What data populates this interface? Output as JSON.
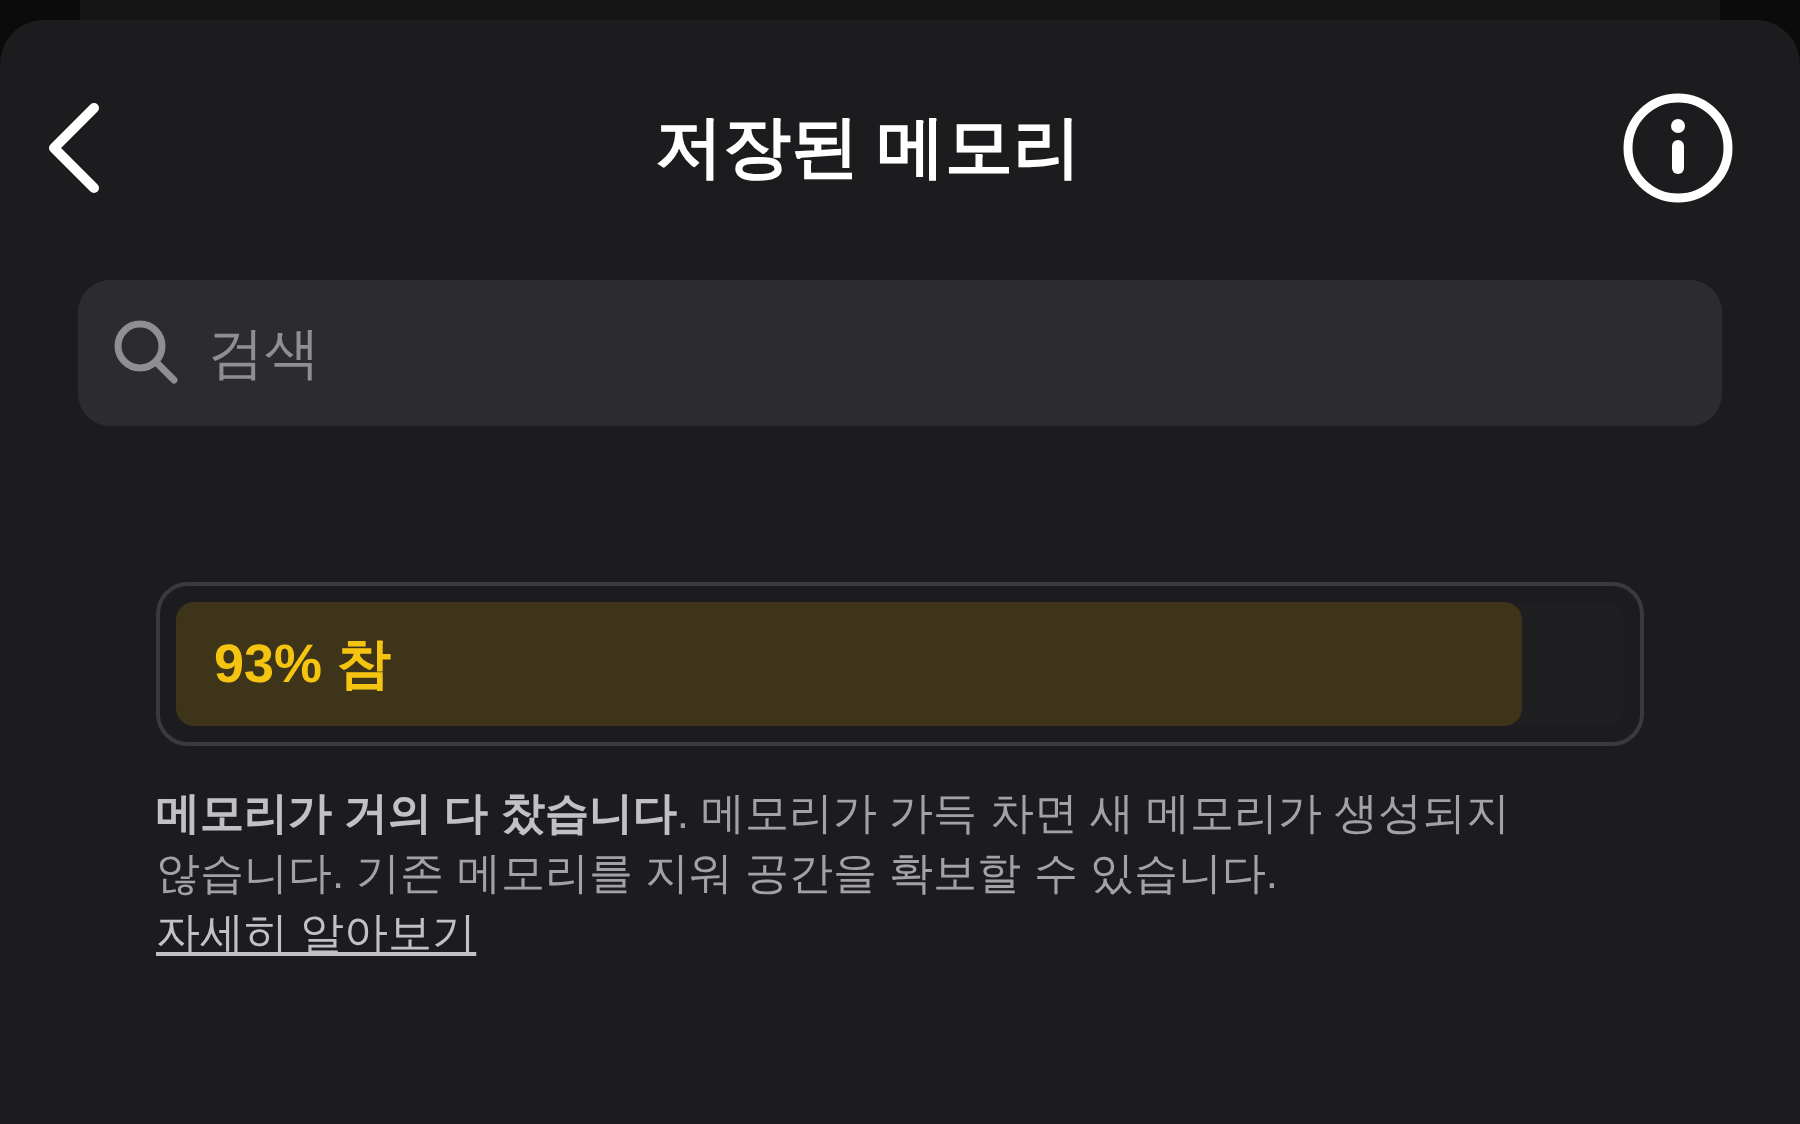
{
  "header": {
    "title": "저장된 메모리"
  },
  "search": {
    "placeholder": "검색"
  },
  "memory_usage": {
    "level": 0.93,
    "label": "93% 참"
  },
  "notice": {
    "text": "**메모리가 거의 다 찼습니다**. 메모리가 가득 차면 새 메모리가 생성되지 않습니다. 기존 메모리를 지워 공간을 확보할 수 있습니다. ",
    "link": "자세히 알아보기"
  }
}
